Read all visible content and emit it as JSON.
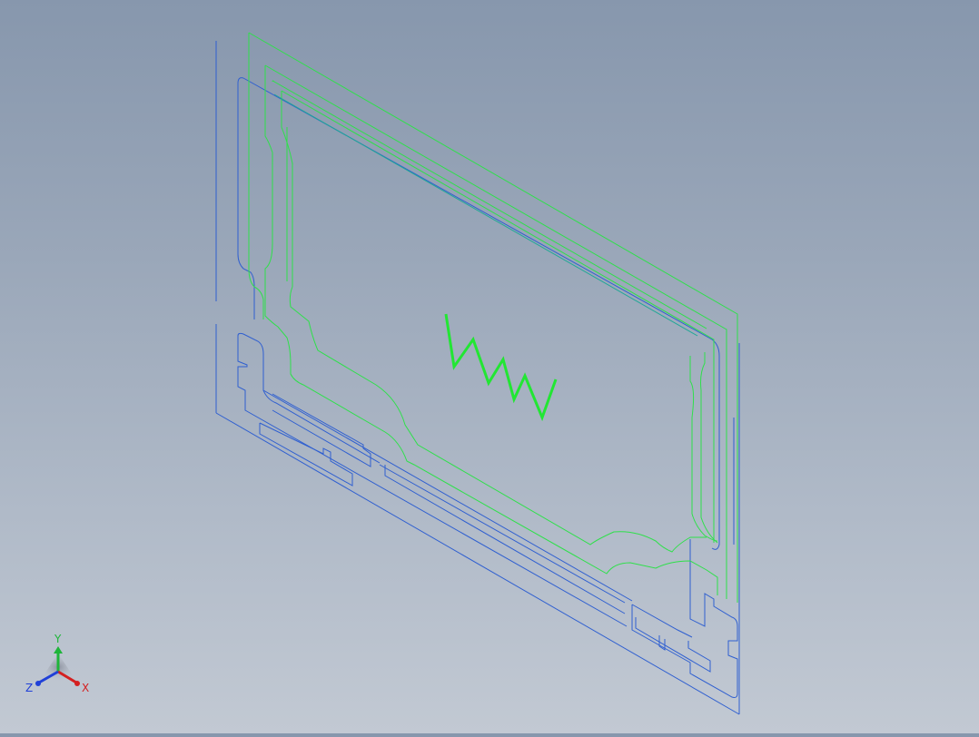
{
  "viewport": {
    "background_top": "#8797ad",
    "background_bottom": "#c2c9d3",
    "edge_color_blue": "#2f5fd0",
    "edge_color_green": "#2ee04a",
    "edge_color_teal": "#1fa896",
    "sketch_text": "WW"
  },
  "triad": {
    "x_label": "X",
    "y_label": "Y",
    "z_label": "Z",
    "x_color": "#d42020",
    "y_color": "#1fb53a",
    "z_color": "#2040d8"
  }
}
